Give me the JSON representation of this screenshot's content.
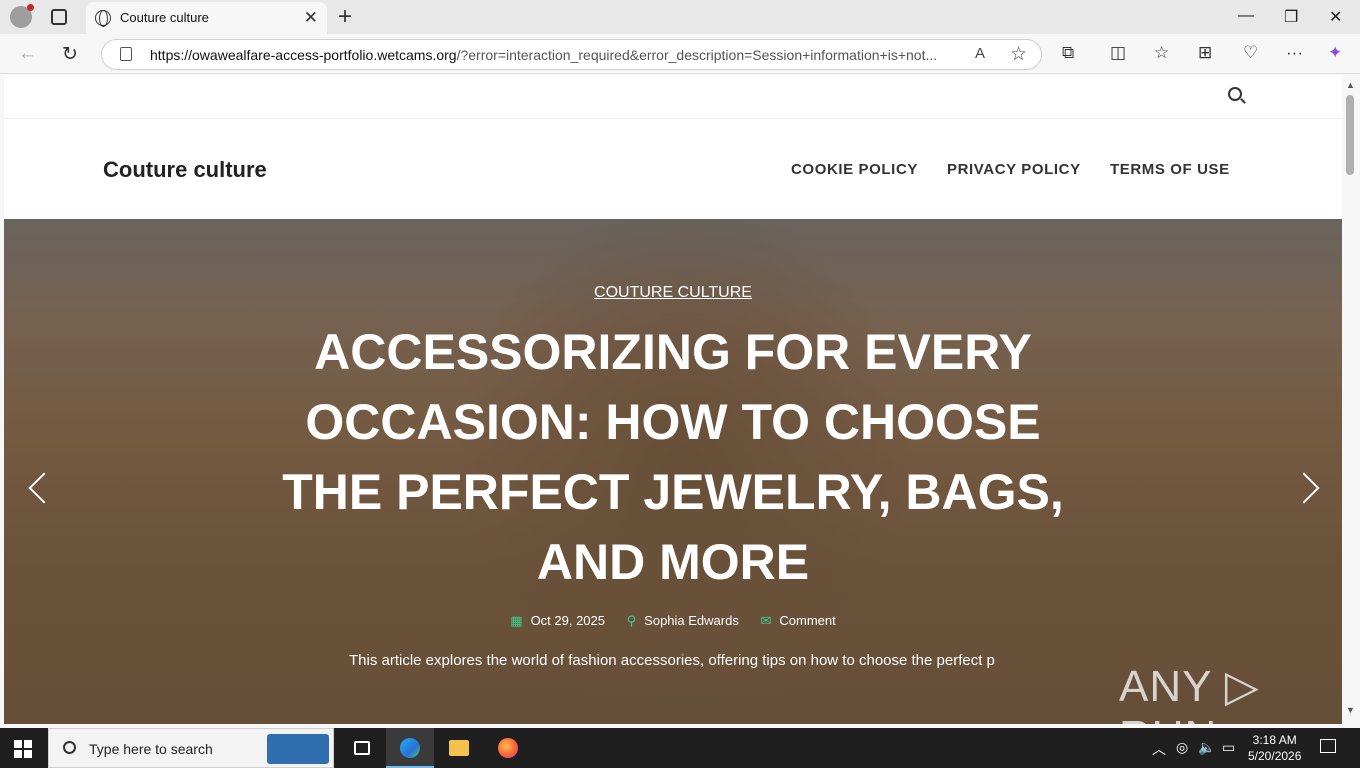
{
  "browser": {
    "tab_title": "Couture culture",
    "tab_close": "✕",
    "new_tab": "+",
    "url_domain": "https://owawealfare-access-portfolio.wetcams.org",
    "url_rest": "/?error=interaction_required&error_description=Session+information+is+not...",
    "read_aloud": "A",
    "favorite_icon": "☆",
    "window_minimize": "—",
    "window_restore": "❐",
    "window_close": "✕",
    "back": "←",
    "refresh": "↻",
    "toolbar_icons": [
      "extensions-icon",
      "split-screen-icon",
      "favorites-icon",
      "collections-icon",
      "performance-icon",
      "more-icon",
      "copilot-icon"
    ],
    "toolbar_glyphs": [
      "⧉",
      "◫",
      "☆",
      "⊞",
      "♡",
      "···",
      "✦"
    ]
  },
  "site": {
    "title": "Couture culture",
    "menu": [
      "COOKIE POLICY",
      "PRIVACY POLICY",
      "TERMS OF USE"
    ]
  },
  "hero": {
    "category": "COUTURE CULTURE",
    "headline": "ACCESSORIZING FOR EVERY OCCASION: HOW TO CHOOSE THE PERFECT JEWELRY, BAGS, AND MORE",
    "date": "Oct 29, 2025",
    "author": "Sophia Edwards",
    "comment": "Comment",
    "excerpt": "This article explores the world of fashion accessories, offering tips on how to choose the perfect p",
    "watermark": "ANY ▷ RUN",
    "accent_color": "#3ecf8e"
  },
  "taskbar": {
    "search_placeholder": "Type here to search",
    "time": "3:18 AM",
    "date": "5/20/2026",
    "tray_up": "︿"
  }
}
